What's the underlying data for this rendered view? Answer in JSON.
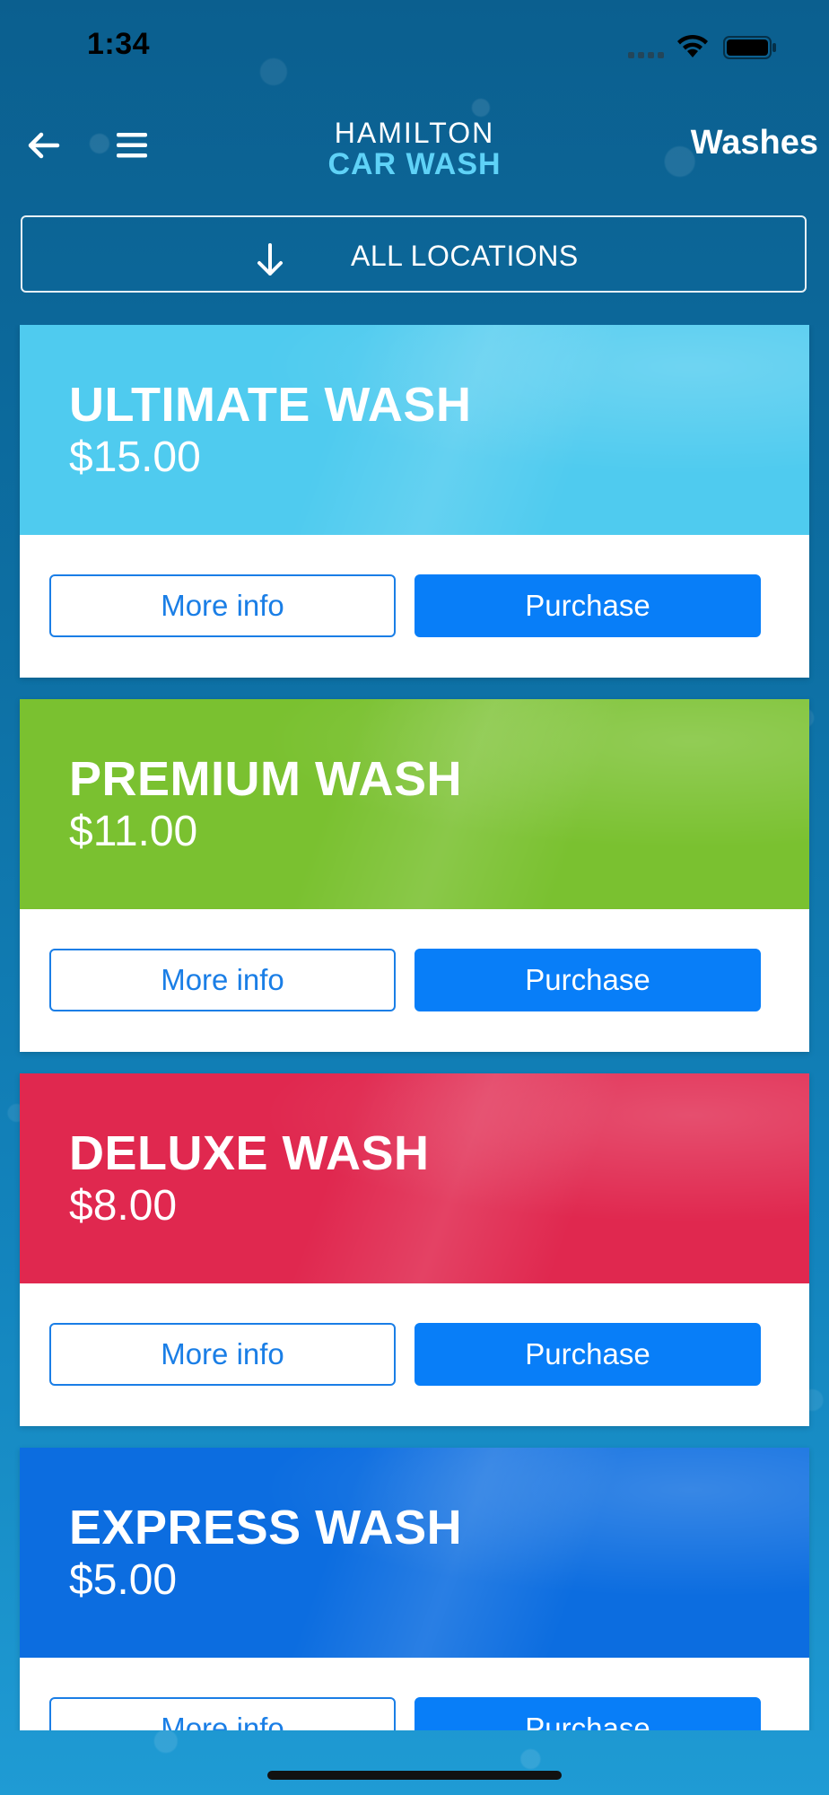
{
  "status_bar": {
    "time": "1:34"
  },
  "nav": {
    "logo_top": "HAMILTON",
    "logo_bottom": "CAR WASH",
    "title": "Washes"
  },
  "location": {
    "label": "ALL LOCATIONS"
  },
  "washes": [
    {
      "name": "ULTIMATE WASH",
      "price": "$15.00",
      "color": "#4fcbef",
      "more_info": "More info",
      "purchase": "Purchase"
    },
    {
      "name": "PREMIUM WASH",
      "price": "$11.00",
      "color": "#7ac130",
      "more_info": "More info",
      "purchase": "Purchase"
    },
    {
      "name": "DELUXE WASH",
      "price": "$8.00",
      "color": "#e0284f",
      "more_info": "More info",
      "purchase": "Purchase"
    },
    {
      "name": "EXPRESS WASH",
      "price": "$5.00",
      "color": "#0c6de0",
      "more_info": "More info",
      "purchase": "Purchase"
    }
  ],
  "colors": {
    "primary_button": "#087ef8",
    "outline_button": "#1a7ee6",
    "logo_accent": "#5fd2f7"
  },
  "icons": {
    "back": "arrow-left-icon",
    "menu": "hamburger-menu-icon",
    "location": "arrow-down-icon",
    "wifi": "wifi-icon",
    "battery": "battery-icon"
  }
}
